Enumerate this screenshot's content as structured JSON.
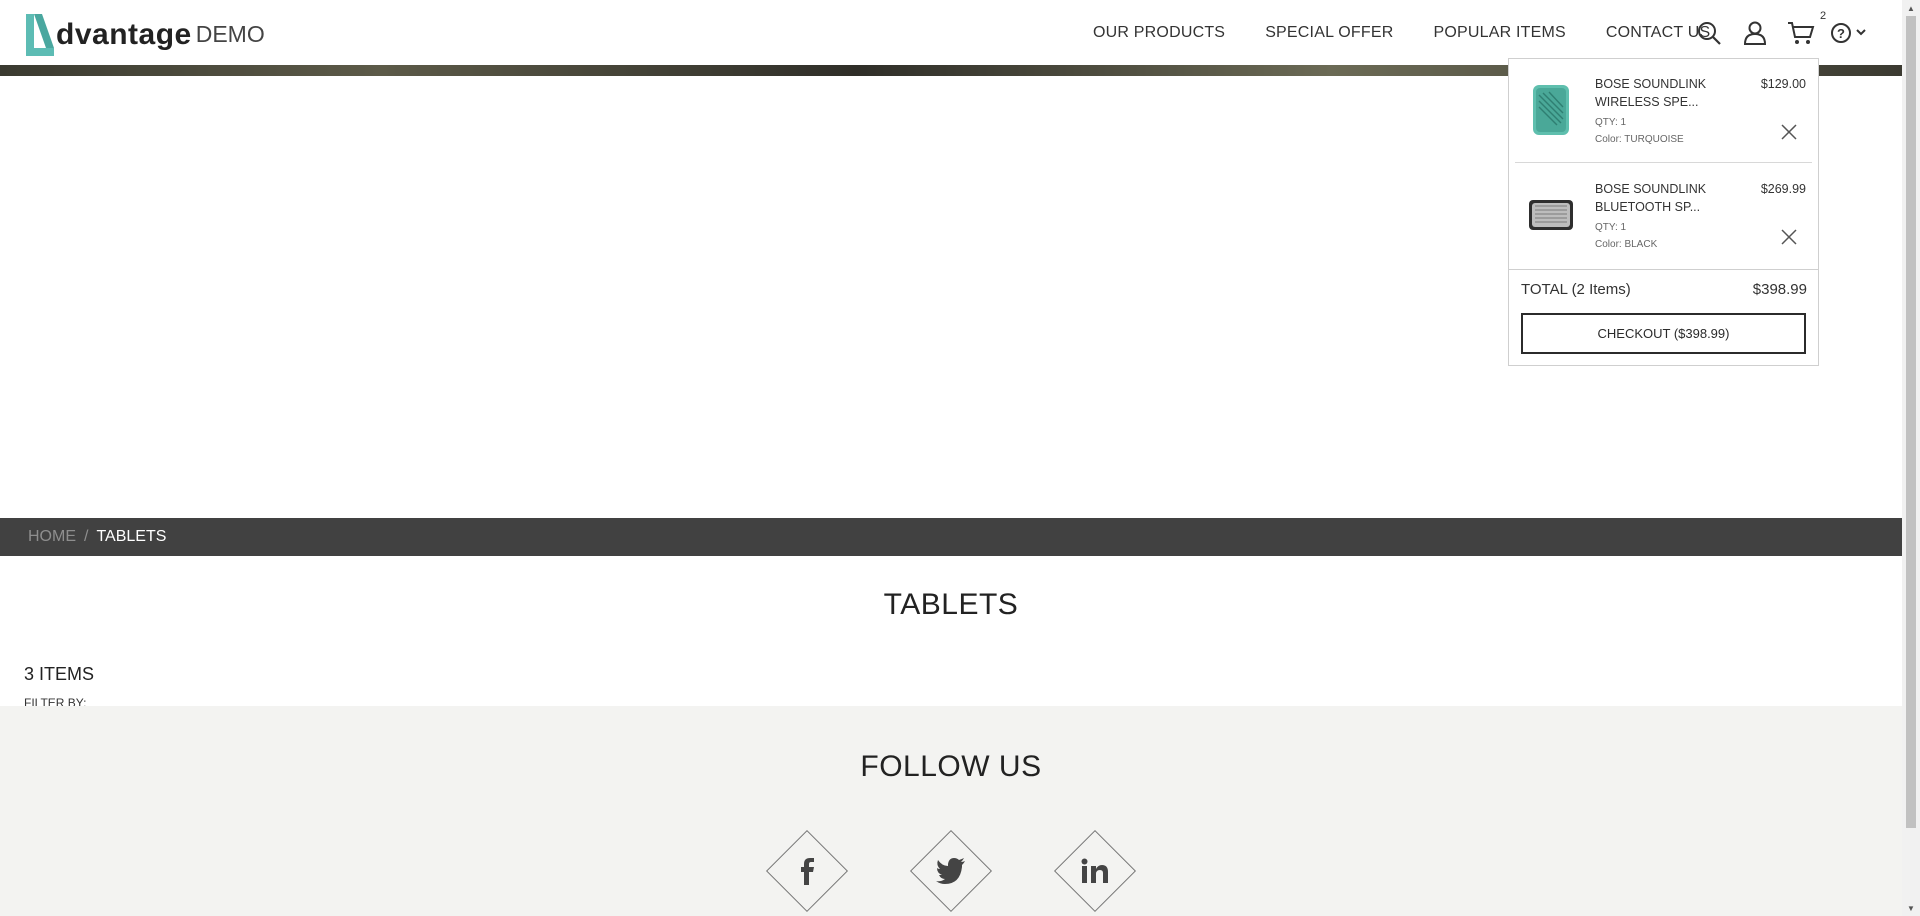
{
  "brand": {
    "logo_text": "dvantage",
    "logo_suffix": "DEMO",
    "accent_color": "#5dbcb4"
  },
  "nav": {
    "items": [
      {
        "label": "OUR PRODUCTS"
      },
      {
        "label": "SPECIAL OFFER"
      },
      {
        "label": "POPULAR ITEMS"
      },
      {
        "label": "CONTACT US"
      }
    ]
  },
  "header_icons": {
    "search": "search-icon",
    "user": "user-icon",
    "cart": "cart-icon",
    "help": "help-icon",
    "cart_count": "2"
  },
  "breadcrumb": {
    "home": "HOME",
    "separator": "/",
    "current": "TABLETS"
  },
  "page": {
    "title": "TABLETS",
    "items_count": "3 ITEMS",
    "filter_label": "FILTER BY:"
  },
  "footer": {
    "follow_title": "FOLLOW US",
    "social": [
      "facebook-icon",
      "twitter-icon",
      "linkedin-icon"
    ]
  },
  "cart": {
    "items": [
      {
        "name": "BOSE SOUNDLINK WIRELESS SPE...",
        "qty": "QTY: 1",
        "color": "Color: TURQUOISE",
        "price": "$129.00",
        "swatch": "#5fbfae"
      },
      {
        "name": "BOSE SOUNDLINK BLUETOOTH SP...",
        "qty": "QTY: 1",
        "color": "Color: BLACK",
        "price": "$269.99",
        "swatch": "#3a3a3a"
      }
    ],
    "total_label": "TOTAL (2 Items)",
    "total_amount": "$398.99",
    "checkout_label": "CHECKOUT ($398.99)"
  }
}
